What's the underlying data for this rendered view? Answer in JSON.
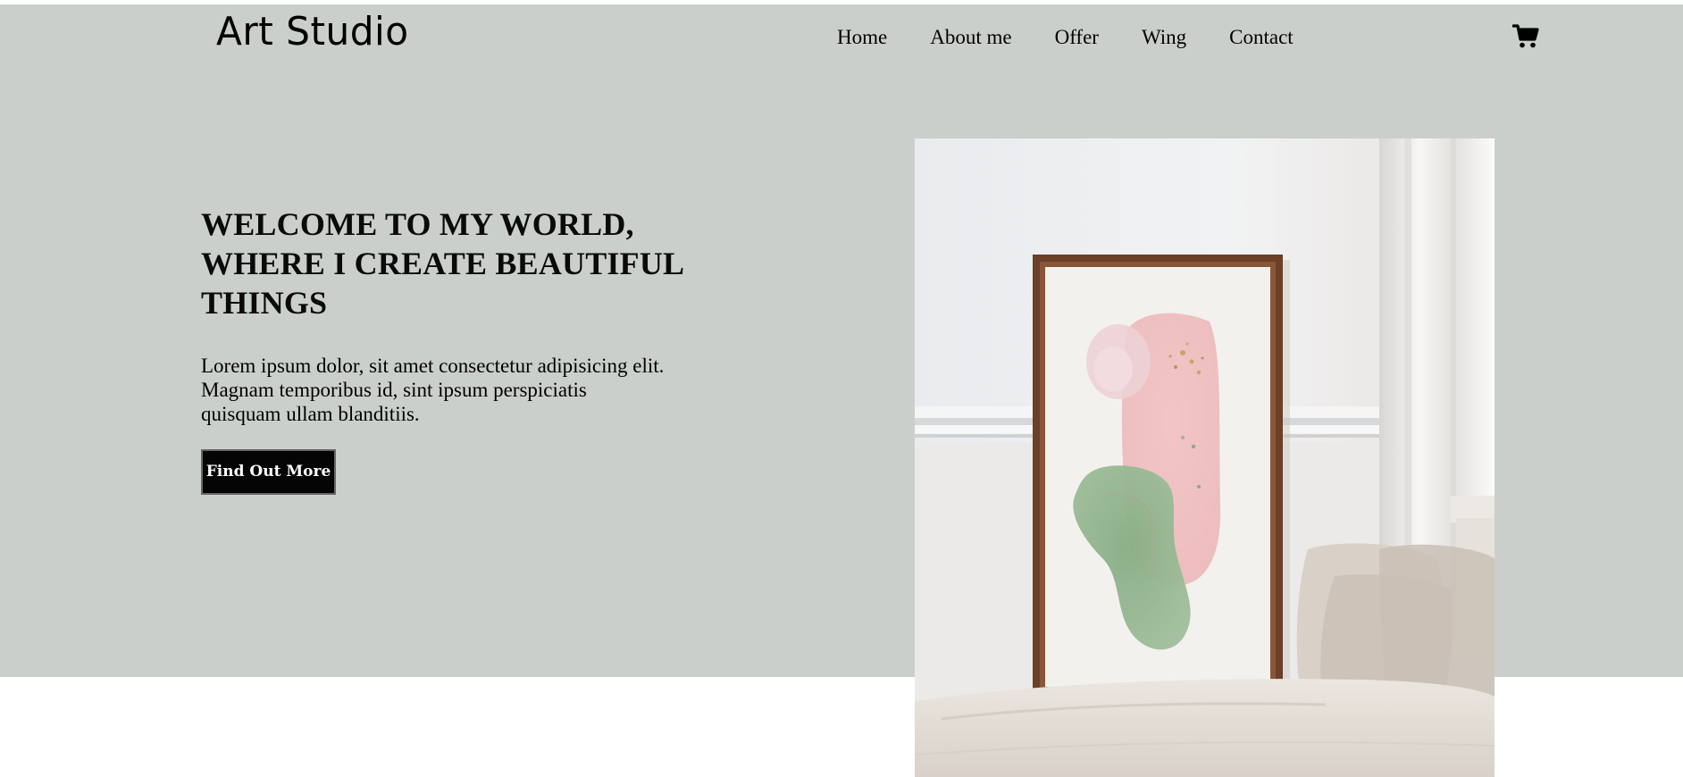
{
  "header": {
    "logo": "Art Studio",
    "nav": [
      "Home",
      "About me",
      "Offer",
      "Wing",
      "Contact"
    ],
    "cart_icon": "shopping-cart-icon"
  },
  "hero": {
    "title": "Welcome to my world, where I create beautiful things",
    "text": "Lorem ipsum dolor, sit amet consectetur adipisicing elit. Magnam temporibus id, sint ipsum perspiciatis quisquam ullam blanditiis.",
    "button_label": "Find Out More",
    "image": "framed-painting-photo"
  },
  "colors": {
    "hero_background": "#cbcfcb",
    "button_background": "#050505",
    "button_text": "#ffffff",
    "text": "#000000",
    "page_background": "#ffffff"
  }
}
